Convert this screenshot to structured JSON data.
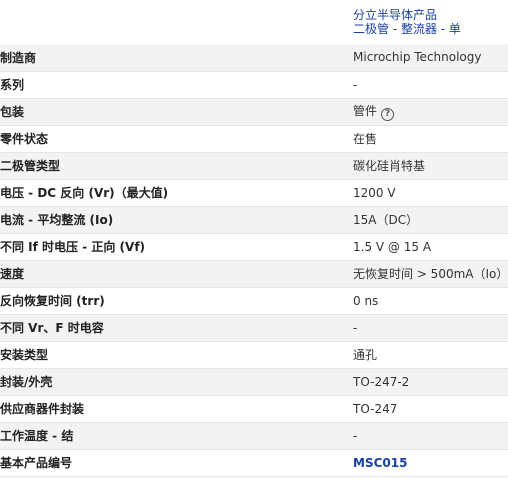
{
  "category": {
    "line1": "分立半导体产品",
    "line2": "二极管 - 整流器 - 单"
  },
  "specs": [
    {
      "label": "制造商",
      "value": "Microchip Technology"
    },
    {
      "label": "系列",
      "value": "-"
    },
    {
      "label": "包装",
      "value": "管件"
    },
    {
      "label": "零件状态",
      "value": "在售"
    },
    {
      "label": "二极管类型",
      "value": "碳化硅肖特基"
    },
    {
      "label": "电压 - DC 反向 (Vr)（最大值)",
      "value": "1200 V"
    },
    {
      "label": "电流 - 平均整流 (Io)",
      "value": "15A（DC）"
    },
    {
      "label": "不同 If 时电压 - 正向 (Vf)",
      "value": "1.5 V @ 15 A"
    },
    {
      "label": "速度",
      "value": "无恢复时间 > 500mA（Io）"
    },
    {
      "label": "反向恢复时间 (trr)",
      "value": "0 ns"
    },
    {
      "label": "不同 Vr、F 时电容",
      "value": "-"
    },
    {
      "label": "安装类型",
      "value": "通孔"
    },
    {
      "label": "封装/外壳",
      "value": "TO-247-2"
    },
    {
      "label": "供应商器件封装",
      "value": "TO-247"
    },
    {
      "label": "工作温度 - 结",
      "value": "-"
    },
    {
      "label": "基本产品编号",
      "value": "MSC015"
    }
  ],
  "icons": {
    "help": "?"
  }
}
